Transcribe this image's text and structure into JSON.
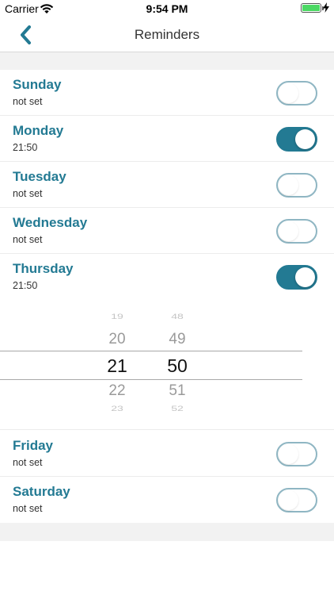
{
  "status_bar": {
    "carrier": "Carrier",
    "time": "9:54 PM",
    "battery_color": "#4cd964"
  },
  "nav": {
    "title": "Reminders",
    "back_icon": "chevron-left-icon"
  },
  "colors": {
    "accent": "#237a93",
    "toggle_off_border": "#8fb6c3",
    "section_gap": "#f2f2f2"
  },
  "days": [
    {
      "name": "Sunday",
      "time": "not set",
      "enabled": false
    },
    {
      "name": "Monday",
      "time": "21:50",
      "enabled": true
    },
    {
      "name": "Tuesday",
      "time": "not set",
      "enabled": false
    },
    {
      "name": "Wednesday",
      "time": "not set",
      "enabled": false
    },
    {
      "name": "Thursday",
      "time": "21:50",
      "enabled": true
    },
    {
      "name": "Friday",
      "time": "not set",
      "enabled": false
    },
    {
      "name": "Saturday",
      "time": "not set",
      "enabled": false
    }
  ],
  "picker": {
    "hours": [
      "19",
      "20",
      "21",
      "22",
      "23"
    ],
    "minutes": [
      "48",
      "49",
      "50",
      "51",
      "52"
    ],
    "selected_hour": "21",
    "selected_minute": "50"
  }
}
